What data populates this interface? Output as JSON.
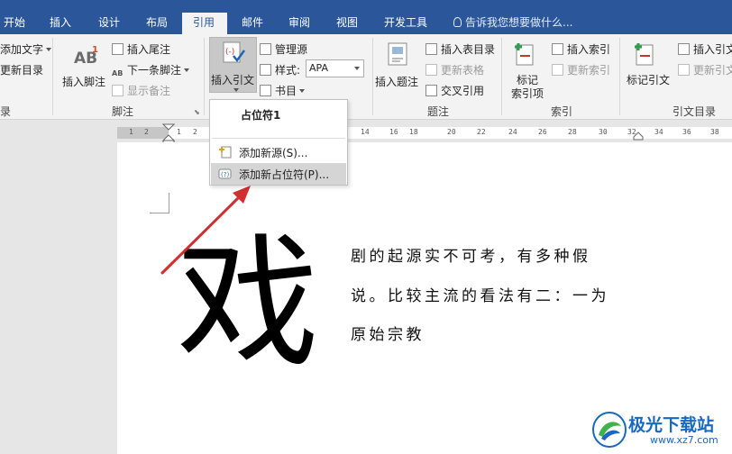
{
  "window": {
    "title": ""
  },
  "tabs": [
    "开始",
    "插入",
    "设计",
    "布局",
    "引用",
    "邮件",
    "审阅",
    "视图",
    "开发工具"
  ],
  "tell_me": "告诉我您想要做什么...",
  "ribbon": {
    "toc": {
      "add_text": "添加文字",
      "update_toc": "更新目录",
      "group": "录"
    },
    "footnotes": {
      "insert_footnote": "插入脚注",
      "insert_endnote": "插入尾注",
      "next_footnote": "下一条脚注",
      "show_notes": "显示备注",
      "group": "脚注"
    },
    "citations": {
      "insert_citation": "插入引文",
      "manage_sources": "管理源",
      "style_label": "样式:",
      "style_value": "APA",
      "bibliography": "书目"
    },
    "captions": {
      "insert_caption": "插入题注",
      "insert_table_of_figures": "插入表目录",
      "update_table": "更新表格",
      "cross_reference": "交叉引用",
      "group": "题注"
    },
    "index": {
      "mark_entry": "标记\n索引项",
      "mark_entry_line1": "标记",
      "mark_entry_line2": "索引项",
      "insert_index": "插入索引",
      "update_index": "更新索引",
      "group": "索引"
    },
    "toa": {
      "mark_citation": "标记引文",
      "insert_toa": "插入引文",
      "update_toa": "更新引文",
      "group": "引文目录"
    }
  },
  "ruler": {
    "ticks": [
      "1",
      "2",
      "1",
      "2",
      "14",
      "16",
      "18",
      "20",
      "22",
      "24",
      "26",
      "28",
      "30",
      "32",
      "34",
      "36",
      "38"
    ]
  },
  "citation_menu": {
    "placeholder_header": "占位符1",
    "add_source": "添加新源(S)...",
    "add_placeholder": "添加新占位符(P)..."
  },
  "document": {
    "big_char": "戏",
    "lines": [
      "剧的起源实不可考，有多种假",
      "说。比较主流的看法有二：一为",
      "原始宗教"
    ]
  },
  "watermark": {
    "text": "极光下载站",
    "url": "www.xz7.com"
  },
  "colors": {
    "ribbon_blue": "#2b579a",
    "arrow_red": "#d03030",
    "watermark_blue": "#1769c2"
  }
}
